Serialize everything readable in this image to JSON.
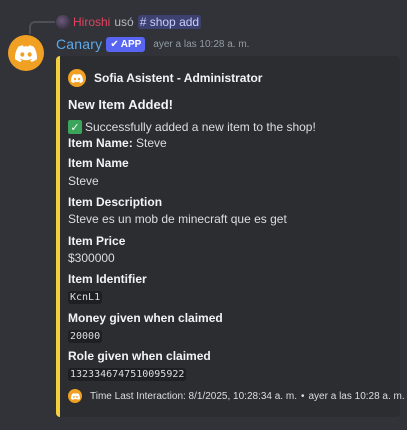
{
  "reply": {
    "user": "Hiroshi",
    "verb": "usó",
    "command": "# shop add"
  },
  "message": {
    "username": "Canary",
    "badge": "APP",
    "timestamp": "ayer a las 10:28 a. m."
  },
  "embed": {
    "accent_color": "#f4d03f",
    "author": "Sofia Asistent - Administrator",
    "title": "New Item Added!",
    "description_emoji": "✓",
    "description": "Successfully added a new item to the shop!",
    "item_name_label": "Item Name:",
    "item_name_inline": "Steve",
    "fields": [
      {
        "name": "Item Name",
        "value": "Steve",
        "code": false
      },
      {
        "name": "Item Description",
        "value": "Steve es un mob de minecraft que es get",
        "code": false
      },
      {
        "name": "Item Price",
        "value": "$300000",
        "code": false
      },
      {
        "name": "Item Identifier",
        "value": "KcnL1",
        "code": true
      },
      {
        "name": "Money given when claimed",
        "value": "20000",
        "code": true
      },
      {
        "name": "Role given when claimed",
        "value": "1323346747510095922",
        "code": true
      }
    ],
    "footer_text": "Time Last Interaction: 8/1/2025, 10:28:34 a. m.",
    "footer_separator": "•",
    "footer_timestamp": "ayer a las 10:28 a. m."
  },
  "icons": {
    "avatar": "discord-logo-icon",
    "app_badge": "checkmark-icon",
    "author": "discord-logo-icon",
    "footer": "discord-logo-icon"
  }
}
